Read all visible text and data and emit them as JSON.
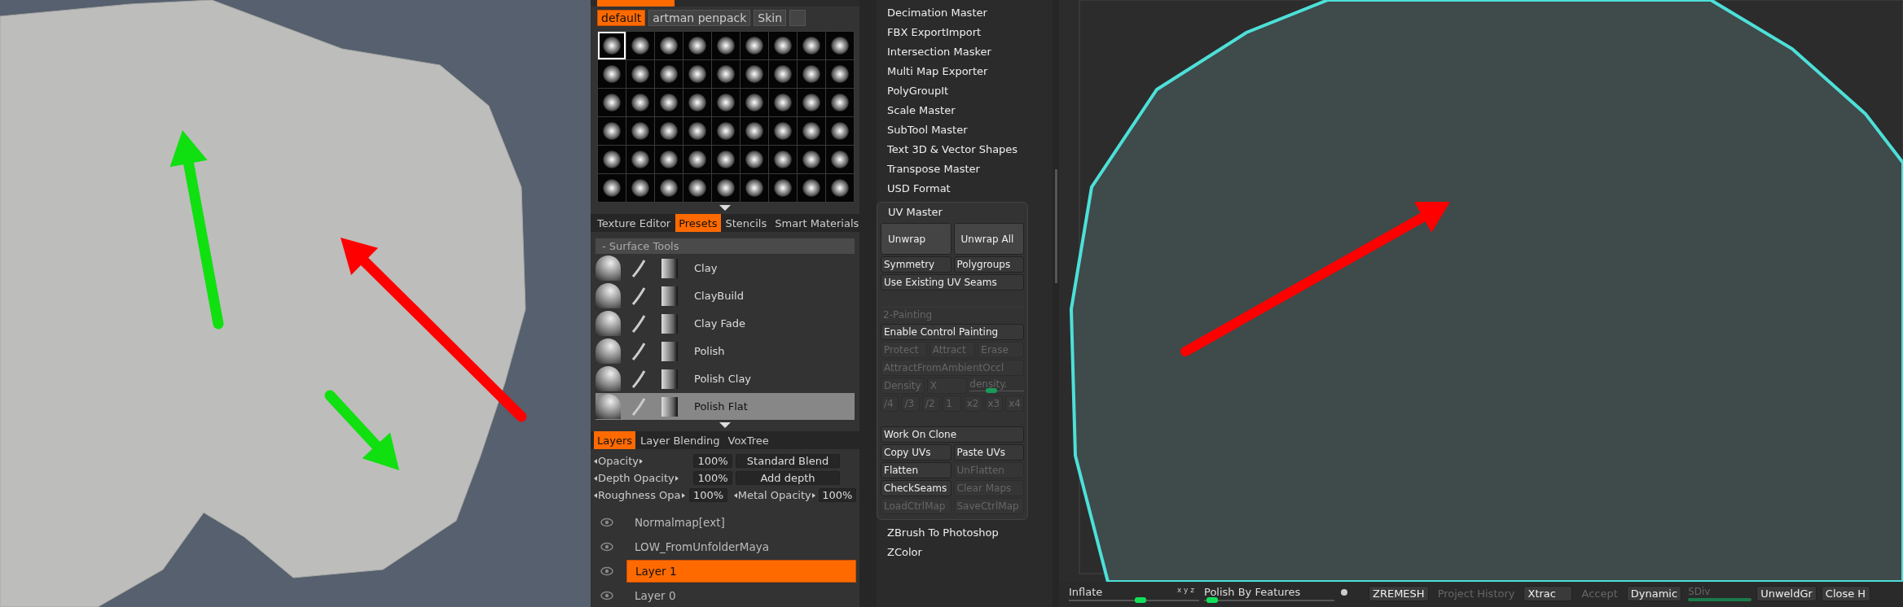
{
  "alphas": {
    "tabs": [
      {
        "label": "default",
        "selected": true
      },
      {
        "label": "artman penpack",
        "selected": false
      },
      {
        "label": "Skin",
        "selected": false
      }
    ],
    "grid": [
      {
        "selected": true
      },
      {
        "selected": false
      },
      {
        "selected": false
      },
      {
        "selected": false
      },
      {
        "selected": false
      },
      {
        "selected": false
      },
      {
        "selected": false
      },
      {
        "selected": false
      },
      {
        "selected": false
      },
      {
        "selected": false
      },
      {
        "selected": false
      },
      {
        "selected": false
      },
      {
        "selected": false
      },
      {
        "selected": false
      },
      {
        "selected": false
      },
      {
        "selected": false
      },
      {
        "selected": false
      },
      {
        "selected": false
      },
      {
        "selected": false
      },
      {
        "selected": false
      },
      {
        "selected": false
      },
      {
        "selected": false
      },
      {
        "selected": false
      },
      {
        "selected": false
      },
      {
        "selected": false
      },
      {
        "selected": false
      },
      {
        "selected": false
      },
      {
        "selected": false
      },
      {
        "selected": false
      },
      {
        "selected": false
      },
      {
        "selected": false
      },
      {
        "selected": false
      },
      {
        "selected": false
      },
      {
        "selected": false
      },
      {
        "selected": false
      },
      {
        "selected": false
      },
      {
        "selected": false
      },
      {
        "selected": false
      },
      {
        "selected": false
      },
      {
        "selected": false
      },
      {
        "selected": false
      },
      {
        "selected": false
      },
      {
        "selected": false
      },
      {
        "selected": false
      },
      {
        "selected": false
      },
      {
        "selected": false
      },
      {
        "selected": false
      },
      {
        "selected": false
      },
      {
        "selected": false
      },
      {
        "selected": false
      },
      {
        "selected": false
      },
      {
        "selected": false
      },
      {
        "selected": false
      },
      {
        "selected": false
      }
    ]
  },
  "texture_tabs": [
    {
      "label": "Texture Editor",
      "selected": false
    },
    {
      "label": "Presets",
      "selected": true
    },
    {
      "label": "Stencils",
      "selected": false
    },
    {
      "label": "Smart Materials",
      "selected": false
    }
  ],
  "presets": {
    "header": "- Surface Tools",
    "items": [
      {
        "label": "Clay",
        "selected": false
      },
      {
        "label": "ClayBuild",
        "selected": false
      },
      {
        "label": "Clay Fade",
        "selected": false
      },
      {
        "label": "Polish",
        "selected": false
      },
      {
        "label": "Polish Clay",
        "selected": false
      },
      {
        "label": "Polish Flat",
        "selected": true
      }
    ]
  },
  "layer_tabs": [
    {
      "label": "Layers",
      "selected": true
    },
    {
      "label": "Layer Blending",
      "selected": false
    },
    {
      "label": "VoxTree",
      "selected": false
    }
  ],
  "layer_settings": {
    "opacity_label": "Opacity",
    "opacity": "100%",
    "blend": "Standard Blend",
    "depth_label": "Depth Opacity",
    "depth": "100%",
    "depth_mode": "Add depth",
    "roughness_label": "Roughness Opa",
    "roughness": "100%",
    "metal_label": "Metal Opacity",
    "metal": "100%"
  },
  "layers": [
    {
      "name": "Normalmap[ext]",
      "selected": false
    },
    {
      "name": "LOW_FromUnfolderMaya",
      "selected": false
    },
    {
      "name": "Layer 1",
      "selected": true
    },
    {
      "name": "Layer 0",
      "selected": false
    }
  ],
  "plugins_top": [
    "Decimation Master",
    "FBX ExportImport",
    "Intersection Masker",
    "Multi Map Exporter",
    "PolyGroupIt",
    "Scale Master",
    "SubTool Master",
    "Text 3D & Vector Shapes",
    "Transpose Master",
    "USD Format"
  ],
  "uv_master": {
    "title": "UV Master",
    "rows": [
      {
        "kind": "big",
        "buttons": [
          {
            "label": "Unwrap",
            "disabled": false
          },
          {
            "label": "Unwrap All",
            "disabled": false
          }
        ]
      },
      {
        "kind": "buttons",
        "buttons": [
          {
            "label": "Symmetry",
            "disabled": false
          },
          {
            "label": "Polygroups",
            "disabled": false
          }
        ]
      },
      {
        "kind": "buttons",
        "buttons": [
          {
            "label": "Use Existing UV Seams",
            "disabled": false
          }
        ]
      },
      {
        "kind": "section",
        "label": "2-Painting"
      },
      {
        "kind": "buttons",
        "buttons": [
          {
            "label": "Enable Control Painting",
            "disabled": false
          }
        ]
      },
      {
        "kind": "buttons",
        "buttons": [
          {
            "label": "Protect",
            "disabled": true
          },
          {
            "label": "Attract",
            "disabled": true
          },
          {
            "label": "Erase",
            "disabled": true
          }
        ]
      },
      {
        "kind": "buttons",
        "buttons": [
          {
            "label": "AttractFromAmbientOccl",
            "disabled": true
          }
        ]
      },
      {
        "kind": "density",
        "buttons": [
          {
            "label": "Density",
            "disabled": true
          },
          {
            "label": "X",
            "disabled": true
          }
        ],
        "slider_label": "density.",
        "level": 0.4
      },
      {
        "kind": "buttons",
        "buttons": [
          {
            "label": "/4",
            "disabled": true
          },
          {
            "label": "/3",
            "disabled": true
          },
          {
            "label": "/2",
            "disabled": true
          },
          {
            "label": "1",
            "disabled": true
          },
          {
            "label": "x2",
            "disabled": true
          },
          {
            "label": "x3",
            "disabled": true
          },
          {
            "label": "x4",
            "disabled": true
          }
        ]
      },
      {
        "kind": "group",
        "buttons": [
          {
            "label": "Work On Clone",
            "disabled": false
          }
        ]
      },
      {
        "kind": "buttons",
        "buttons": [
          {
            "label": "Copy UVs",
            "disabled": false
          },
          {
            "label": "Paste UVs",
            "disabled": false
          }
        ]
      },
      {
        "kind": "buttons",
        "buttons": [
          {
            "label": "Flatten",
            "disabled": false
          },
          {
            "label": "UnFlatten",
            "disabled": true
          }
        ]
      },
      {
        "kind": "buttons",
        "buttons": [
          {
            "label": "CheckSeams",
            "disabled": false
          },
          {
            "label": "Clear Maps",
            "disabled": true
          }
        ]
      },
      {
        "kind": "buttons",
        "buttons": [
          {
            "label": "LoadCtrlMap",
            "disabled": true
          },
          {
            "label": "SaveCtrlMap",
            "disabled": true
          }
        ]
      }
    ]
  },
  "plugins_bottom": [
    "ZBrush To Photoshop",
    "ZColor"
  ],
  "bottom_bar": [
    {
      "kind": "slider",
      "label": "Inflate",
      "axes": "x y z",
      "level": 0.55
    },
    {
      "kind": "slider",
      "label": "Polish By Features",
      "level": 0.06,
      "dot": true
    },
    {
      "kind": "button",
      "label": "ZREMESH",
      "disabled": false
    },
    {
      "kind": "button",
      "label": "Project History",
      "disabled": true
    },
    {
      "kind": "button",
      "label": "Xtrac",
      "disabled": false
    },
    {
      "kind": "button",
      "label": "Accept",
      "disabled": true
    },
    {
      "kind": "button",
      "label": "Dynamic",
      "disabled": false
    },
    {
      "kind": "meter",
      "label": "SDiv",
      "disabled": true
    },
    {
      "kind": "button",
      "label": "UnweldGr",
      "disabled": false
    },
    {
      "kind": "button",
      "label": "Close H",
      "disabled": false
    }
  ]
}
